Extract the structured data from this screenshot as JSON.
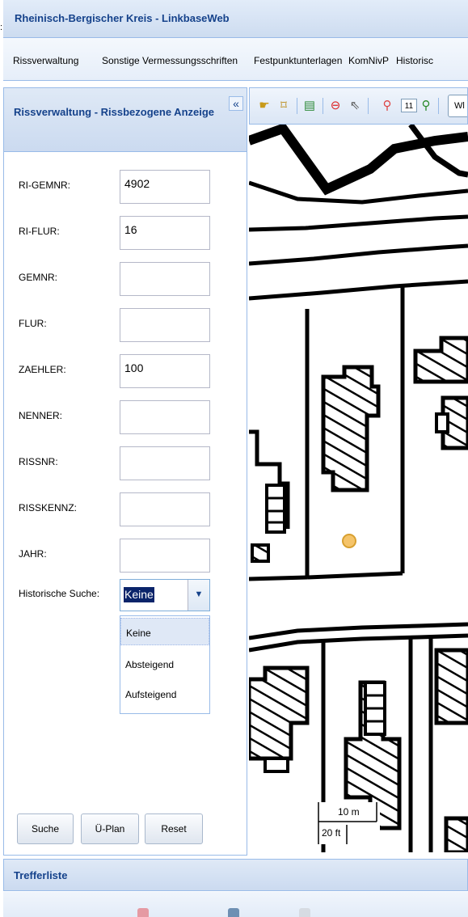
{
  "app": {
    "title": "Rheinisch-Bergischer Kreis - LinkbaseWeb"
  },
  "menu": {
    "items": [
      "Rissverwaltung",
      "Sonstige Vermessungsschriften",
      "Festpunktunterlagen",
      "KomNivP",
      "Historisc"
    ]
  },
  "left_panel": {
    "title": "Rissverwaltung - Rissbezogene Anzeige",
    "collapse_icon": "double-chevron-left-icon",
    "fields": [
      {
        "label": "RI-GEMNR:",
        "value": "4902"
      },
      {
        "label": "RI-FLUR:",
        "value": "16"
      },
      {
        "label": "GEMNR:",
        "value": ""
      },
      {
        "label": "FLUR:",
        "value": ""
      },
      {
        "label": "ZAEHLER:",
        "value": "100"
      },
      {
        "label": "NENNER:",
        "value": ""
      },
      {
        "label": "RISSNR:",
        "value": ""
      },
      {
        "label": "RISSKENNZ:",
        "value": ""
      },
      {
        "label": "JAHR:",
        "value": ""
      }
    ],
    "historic_search": {
      "label": "Historische Suche:",
      "value": "Keine",
      "options": [
        "Keine",
        "Absteigend",
        "Aufsteigend"
      ],
      "selected_index": 0
    },
    "buttons": {
      "search": "Suche",
      "overview": "Ü-Plan",
      "reset": "Reset"
    }
  },
  "map": {
    "toolbar": {
      "icons": [
        "pan-hand-icon",
        "zoom-extent-icon",
        "export-icon",
        "stop-icon",
        "pointer-icon",
        "zoom-out-icon",
        "zoom-in-icon"
      ],
      "zoom_level": "11",
      "view_button": "Wl"
    },
    "scale": {
      "metric": "10 m",
      "imperial": "20 ft"
    },
    "marker_color": "#f5c46a"
  },
  "results": {
    "title": "Trefferliste"
  },
  "colors": {
    "accent_text": "#15428b",
    "border": "#99bbe8",
    "selection": "#0a246a"
  }
}
